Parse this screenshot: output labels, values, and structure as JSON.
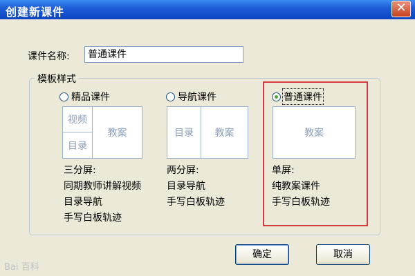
{
  "window": {
    "title": "创建新课件",
    "close_glyph": "✕"
  },
  "form": {
    "name_label": "课件名称:",
    "name_value": "普通课件"
  },
  "template_group": {
    "legend": "模板样式",
    "options": [
      {
        "label": "精品课件",
        "selected": false,
        "preview": {
          "left_top": "视频",
          "left_bottom": "目录",
          "right": "教案"
        },
        "desc": [
          "三分屏:",
          "同期教师讲解视频",
          "目录导航",
          "手写白板轨迹"
        ]
      },
      {
        "label": "导航课件",
        "selected": false,
        "preview": {
          "left": "目录",
          "right": "教案"
        },
        "desc": [
          "两分屏:",
          "目录导航",
          "手写白板轨迹"
        ]
      },
      {
        "label": "普通课件",
        "selected": true,
        "preview": {
          "center": "教案"
        },
        "desc": [
          "单屏:",
          "纯教案课件",
          "手写白板轨迹"
        ]
      }
    ]
  },
  "buttons": {
    "ok": "确定",
    "cancel": "取消"
  },
  "watermark": "Bai 百科",
  "colors": {
    "title_bar": "#0a44c2",
    "dialog_bg": "#ece9d8",
    "selection_border": "#d63a3a",
    "radio_dot": "#4da834"
  },
  "icons": {
    "close": "close-icon",
    "watermark": "baidu-paw-icon"
  }
}
